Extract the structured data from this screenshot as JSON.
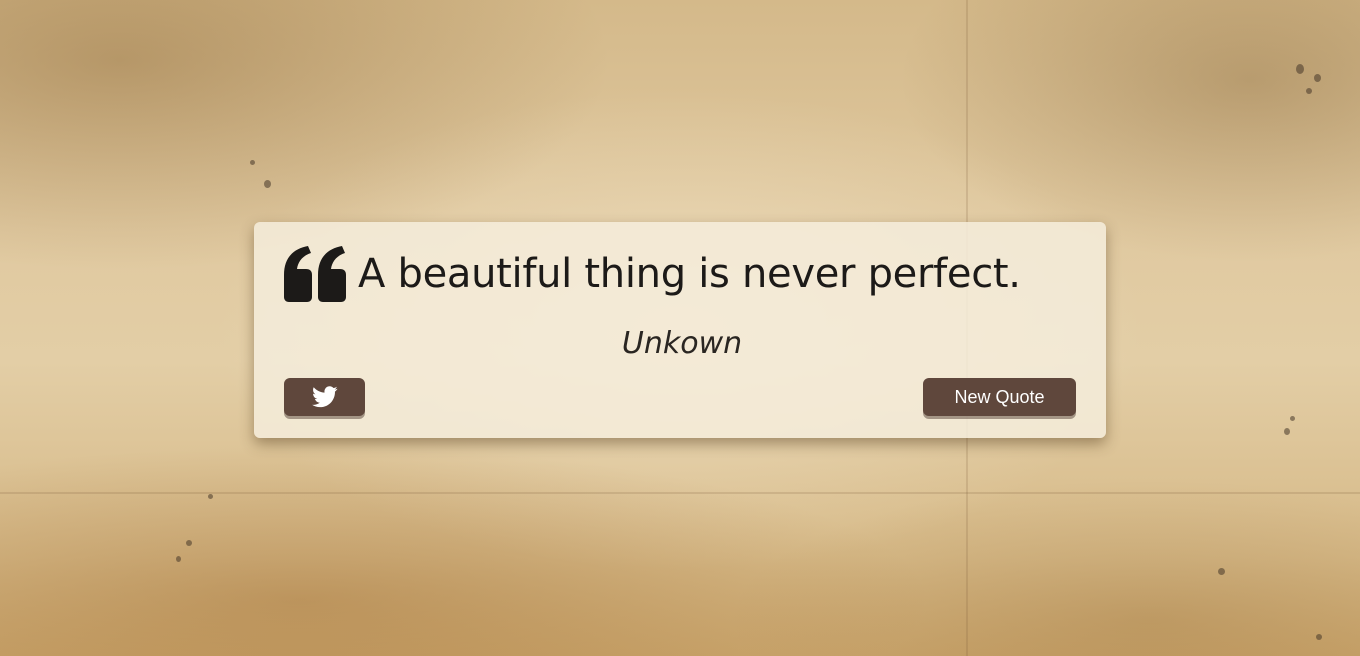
{
  "quote": {
    "icon": "quote-left-icon",
    "text": "A beautiful thing is never perfect.",
    "author": "Unkown"
  },
  "actions": {
    "tweet_icon": "twitter-icon",
    "new_quote_label": "New Quote"
  },
  "colors": {
    "button_bg": "#5f473c",
    "button_text": "#ffffff",
    "card_bg": "#f4ecdb",
    "text": "#1c1a18"
  }
}
